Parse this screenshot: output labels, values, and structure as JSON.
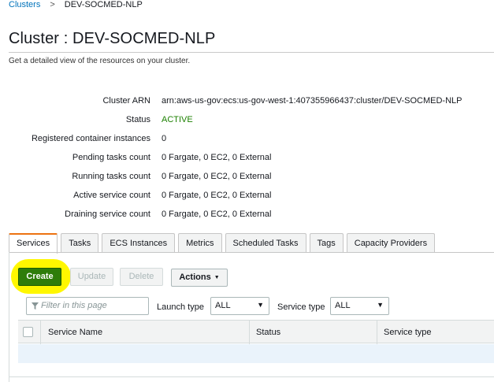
{
  "breadcrumb": {
    "parent": "Clusters",
    "separator": ">",
    "current": "DEV-SOCMED-NLP"
  },
  "page": {
    "title": "Cluster : DEV-SOCMED-NLP",
    "subtitle": "Get a detailed view of the resources on your cluster."
  },
  "details": [
    {
      "label": "Cluster ARN",
      "value": "arn:aws-us-gov:ecs:us-gov-west-1:407355966437:cluster/DEV-SOCMED-NLP"
    },
    {
      "label": "Status",
      "value": "ACTIVE"
    },
    {
      "label": "Registered container instances",
      "value": "0"
    },
    {
      "label": "Pending tasks count",
      "value": "0 Fargate, 0 EC2, 0 External"
    },
    {
      "label": "Running tasks count",
      "value": "0 Fargate, 0 EC2, 0 External"
    },
    {
      "label": "Active service count",
      "value": "0 Fargate, 0 EC2, 0 External"
    },
    {
      "label": "Draining service count",
      "value": "0 Fargate, 0 EC2, 0 External"
    }
  ],
  "tabs": [
    "Services",
    "Tasks",
    "ECS Instances",
    "Metrics",
    "Scheduled Tasks",
    "Tags",
    "Capacity Providers"
  ],
  "active_tab": "Services",
  "toolbar": {
    "create_label": "Create",
    "update_label": "Update",
    "delete_label": "Delete",
    "actions_label": "Actions"
  },
  "filters": {
    "search_placeholder": "Filter in this page",
    "launch_type_label": "Launch type",
    "launch_type_value": "ALL",
    "service_type_label": "Service type",
    "service_type_value": "ALL"
  },
  "table": {
    "columns": [
      "Service Name",
      "Status",
      "Service type"
    ]
  },
  "colors": {
    "link": "#0073bb",
    "status_active": "#1d8102",
    "create_button": "#2e7d0a",
    "active_tab_accent": "#ec7211",
    "annotation_highlight": "#fff700"
  },
  "icons": {
    "filter": "funnel-icon",
    "dropdown": "caret-down-icon"
  }
}
